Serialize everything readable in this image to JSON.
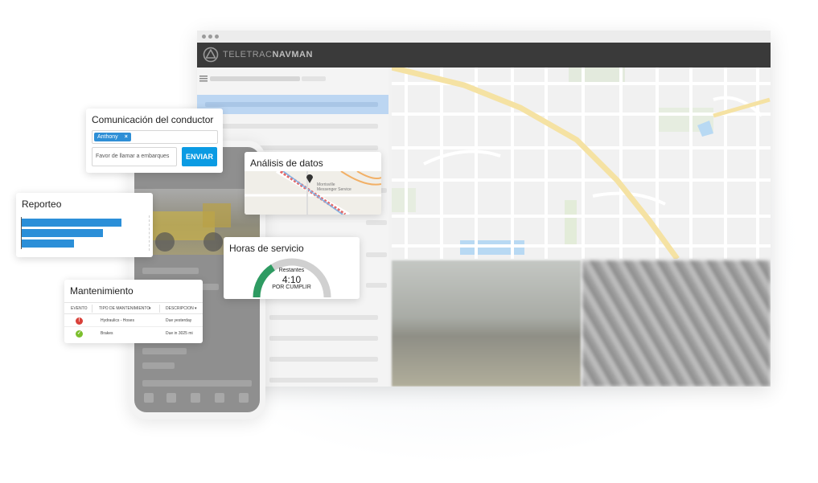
{
  "app": {
    "brand_left": "TELETRAC",
    "brand_right": "NAVMAN"
  },
  "colors": {
    "accent": "#0b9be3",
    "bar": "#2b8fd8",
    "gauge_fill": "#2e9b62",
    "gauge_track": "#d0d0d0",
    "status_red": "#d9413a",
    "status_green": "#7cbf2d",
    "appbar": "#3a3a3a"
  },
  "icons": {
    "logo": "teletrac-logo-icon",
    "menu": "hamburger-menu-icon",
    "remove_tag": "close-icon",
    "map_pin": "map-pin-icon"
  },
  "comunicacion": {
    "title": "Comunicación del conductor",
    "recipient_tag": "Anthony",
    "remove_glyph": "×",
    "message_value": "Favor de llamar a embarques",
    "send_label": "ENVIAR"
  },
  "analisis": {
    "title": "Análisis de datos",
    "map_label_1": "Morrisville",
    "map_label_2": "Messenger Service"
  },
  "reporteo": {
    "title": "Reporteo",
    "bars": [
      0.8,
      0.65,
      0.42
    ]
  },
  "horas": {
    "title": "Horas de servicio",
    "remaining_label": "Restantes",
    "time_value": "4:10",
    "status_label": "POR CUMPLIR",
    "progress": 0.32
  },
  "mantenimiento": {
    "title": "Mantenimiento",
    "columns": [
      "EVENTO",
      "TIPO DE MANTENIMIENTO",
      "DESCRIPCION"
    ],
    "rows": [
      {
        "status": "red",
        "type": "Hydraulics - Hoses",
        "description": "Due yesterday"
      },
      {
        "status": "green",
        "type": "Brakes",
        "description": "Due in 3025 mi"
      }
    ]
  }
}
